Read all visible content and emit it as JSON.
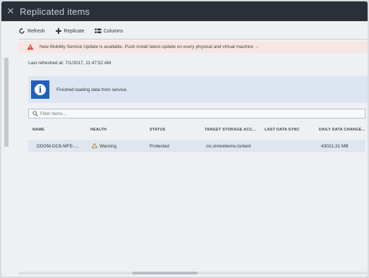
{
  "window": {
    "title": "Replicated items"
  },
  "toolbar": {
    "refresh_label": "Refresh",
    "replicate_label": "Replicate",
    "columns_label": "Columns"
  },
  "alert": {
    "text": "New Mobility Service Update is available. Push install latest update on every physical and virtual machine →",
    "color": "#d9442e"
  },
  "last_refreshed": "Last refreshed at: 7/1/2017, 11:47:52 AM",
  "info": {
    "text": "Finished loading data from service."
  },
  "filter": {
    "placeholder": "Filter items..."
  },
  "table": {
    "columns": [
      "NAME",
      "HEALTH",
      "STATUS",
      "TARGET STORAGE ACC...",
      "LAST DATA SYNC",
      "DAILY DATA CHANGE..."
    ],
    "rows": [
      {
        "name": "DDOM-DC8-MFE-...",
        "health": "Warning",
        "status": "Protected",
        "target": "cic.vimnetwmo.lsntent",
        "sync": "",
        "change": "43021.31 MB"
      }
    ]
  },
  "icons": {
    "alert": "warning-triangle-icon",
    "info": "info-icon",
    "health": "warning-icon"
  },
  "colors": {
    "accent": "#1f5fbf",
    "titlebar": "#2a2f3a"
  }
}
